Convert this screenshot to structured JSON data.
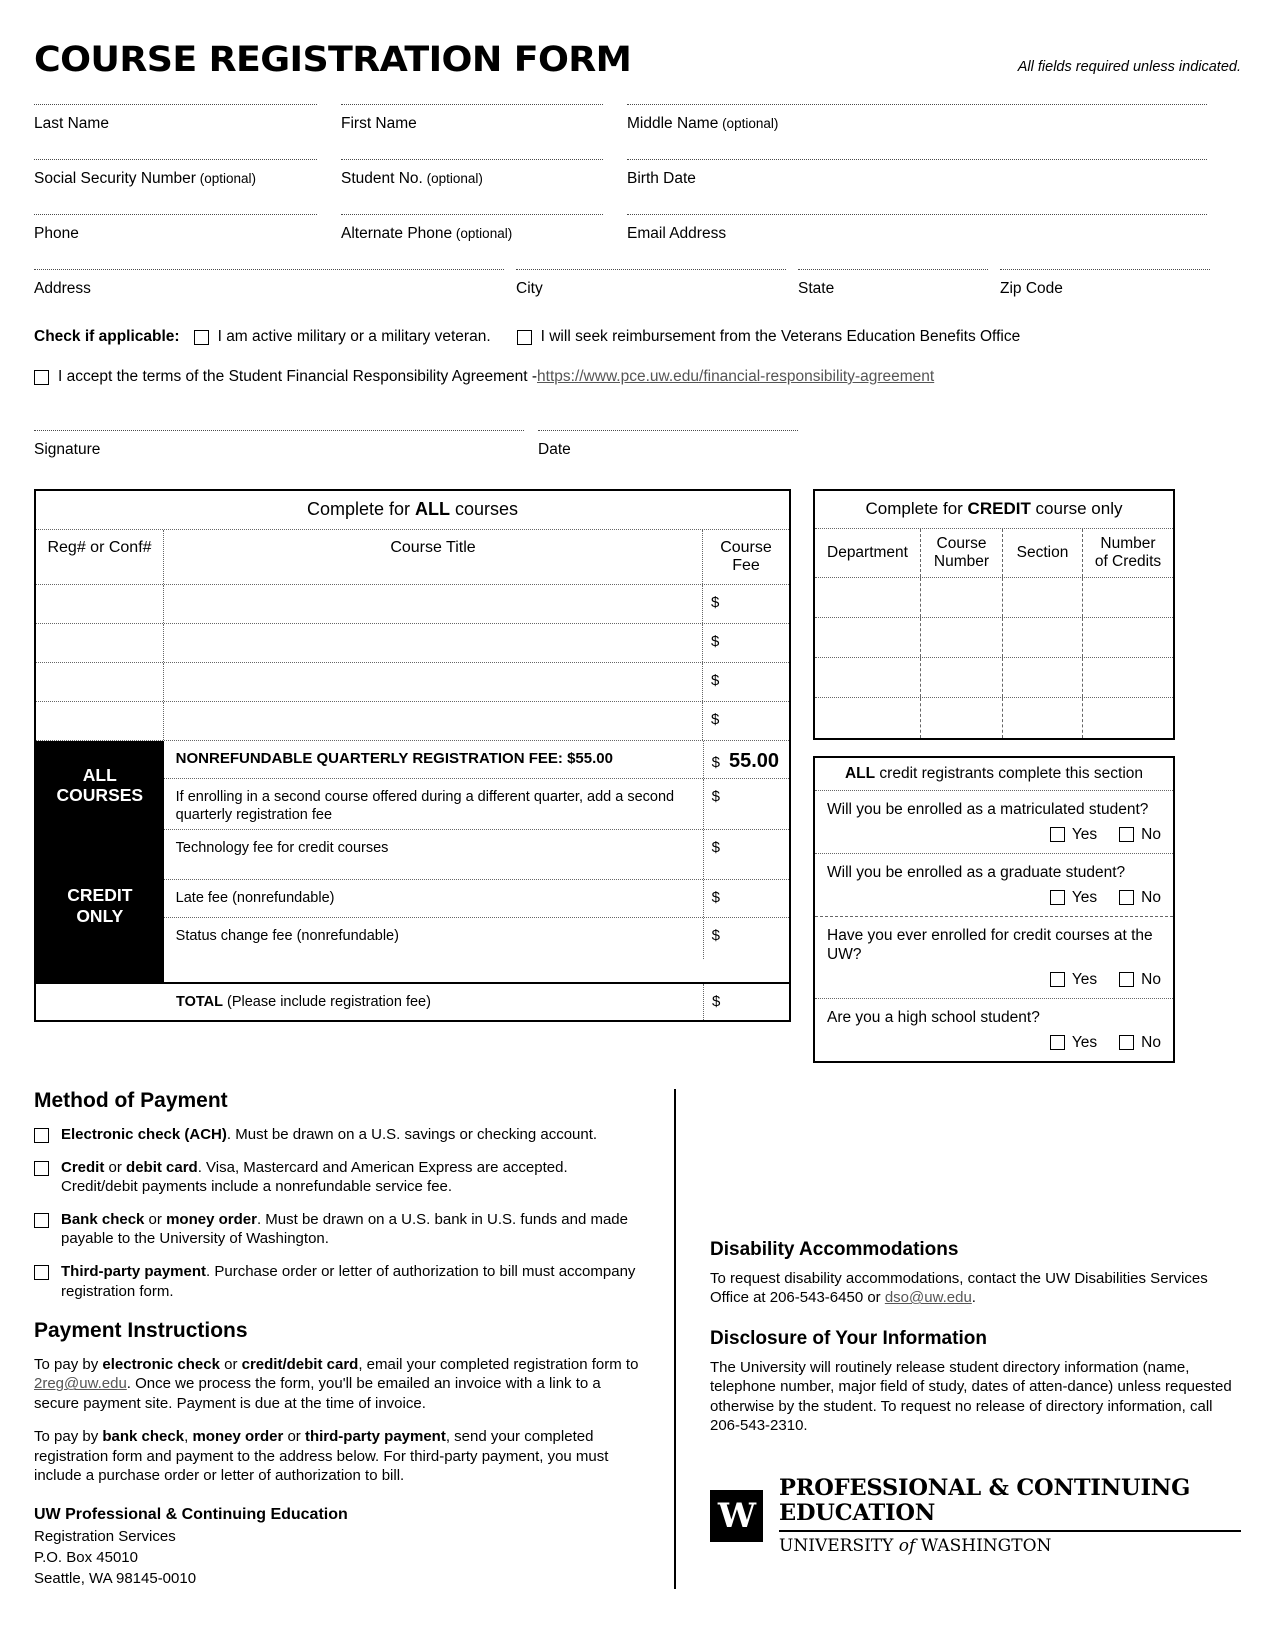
{
  "header": {
    "title": "COURSE REGISTRATION FORM",
    "note": "All fields required unless indicated."
  },
  "fields": {
    "last_name": "Last Name",
    "first_name": "First Name",
    "middle_name": "Middle Name",
    "middle_name_optional": " (optional)",
    "ssn": "Social Security Number",
    "ssn_optional": " (optional)",
    "student_no": "Student No.",
    "student_no_optional": " (optional)",
    "birth_date": "Birth Date",
    "phone": "Phone",
    "alt_phone": "Alternate Phone",
    "alt_phone_optional": " (optional)",
    "email": "Email Address",
    "address": "Address",
    "city": "City",
    "state": "State",
    "zip": "Zip Code",
    "signature": "Signature",
    "date": "Date"
  },
  "checks": {
    "prefix": "Check if applicable:",
    "military": "I am active military or a military veteran.",
    "veterans_benefits": "I will seek reimbursement from the Veterans Education Benefits Office",
    "agreement_text": "I accept the terms of the Student Financial Responsibility Agreement - ",
    "agreement_link": "https://www.pce.uw.edu/financial-responsibility-agreement"
  },
  "all_courses_table": {
    "caption_pre": "Complete for ",
    "caption_bold": "ALL",
    "caption_post": " courses",
    "columns": [
      "Reg# or Conf#",
      "Course Title",
      "Course Fee"
    ],
    "blank_rows": 4,
    "dollar": "$",
    "block_all": "ALL\nCOURSES",
    "block_all_line1": "ALL",
    "block_all_line2": "COURSES",
    "block_credit_line1": "CREDIT",
    "block_credit_line2": "ONLY",
    "fee_rows": [
      {
        "label": "NONREFUNDABLE QUARTERLY REGISTRATION FEE: $55.00",
        "bold": true,
        "amount": "55.00"
      },
      {
        "label": "If enrolling in a second course offered during a different quarter, add a second quarterly registration fee",
        "bold": false,
        "amount": ""
      },
      {
        "label": "Technology fee for credit courses",
        "bold": false,
        "amount": ""
      },
      {
        "label": "Late fee (nonrefundable)",
        "bold": false,
        "amount": ""
      },
      {
        "label": "Status change fee (nonrefundable)",
        "bold": false,
        "amount": ""
      }
    ],
    "total_bold": "TOTAL",
    "total_rest": " (Please include registration fee)"
  },
  "credit_table": {
    "caption_pre": "Complete for ",
    "caption_bold": "CREDIT",
    "caption_post": " course only",
    "columns": [
      "Department",
      "Course\nNumber",
      "Section",
      "Number\nof Credits"
    ],
    "col1": "Department",
    "col2a": "Course",
    "col2b": "Number",
    "col3": "Section",
    "col4a": "Number",
    "col4b": "of Credits",
    "blank_rows": 4
  },
  "credit_questions": {
    "caption_bold": "ALL",
    "caption_rest": " credit registrants complete this section",
    "yes": "Yes",
    "no": "No",
    "items": [
      "Will you be enrolled as a matriculated student?",
      "Will you be enrolled as a graduate student?",
      "Have you ever enrolled for credit courses at the UW?",
      "Are you a high school student?"
    ]
  },
  "payment": {
    "heading": "Method of Payment",
    "options": [
      {
        "bold": "Electronic check (ACH)",
        "rest": ". Must be drawn on a U.S. savings or checking account."
      },
      {
        "bold": "Credit",
        "mid": " or ",
        "bold2": "debit card",
        "rest": ". Visa, Mastercard and American Express are accepted. Credit/debit payments include a nonrefundable service fee."
      },
      {
        "bold": "Bank check",
        "mid": " or ",
        "bold2": "money order",
        "rest": ". Must be drawn on a U.S. bank in U.S. funds and made payable to the University of Washington."
      },
      {
        "bold": "Third-party payment",
        "rest": ". Purchase order or letter of authorization to bill must accompany registration form."
      }
    ],
    "instructions_heading": "Payment Instructions",
    "p1_a": "To pay by ",
    "p1_b1": "electronic check",
    "p1_c": " or ",
    "p1_b2": "credit/debit card",
    "p1_d": ", email your completed registration form to ",
    "p1_email": "2reg@uw.edu",
    "p1_e": ". Once we process the form, you'll be emailed an invoice with a link to a secure payment site. Payment is due at the time of invoice.",
    "p2_a": "To pay by ",
    "p2_b1": "bank check",
    "p2_c1": ", ",
    "p2_b2": "money order",
    "p2_c2": " or ",
    "p2_b3": "third-party payment",
    "p2_d": ", send your completed registration form and payment to the address below. For third-party payment, you must include a purchase order or letter of authorization to bill.",
    "mail_address": [
      "UW Professional & Continuing Education",
      "Registration Services",
      "P.O. Box 45010",
      "Seattle, WA 98145-0010"
    ]
  },
  "right_column": {
    "disability_heading": "Disability Accommodations",
    "disability_text_a": "To request disability accommodations, contact the UW Disabilities Services Office at 206-543-6450 or ",
    "disability_email": "dso@uw.edu",
    "disability_text_b": ".",
    "disclosure_heading": "Disclosure of Your Information",
    "disclosure_text": "The University will routinely release student directory information (name, telephone number, major field of study, dates of atten-dance) unless requested otherwise by the student. To request no release of directory information, call 206-543-2310."
  },
  "logo": {
    "mark": "W",
    "line1": "PROFESSIONAL & CONTINUING EDUCATION",
    "line2_a": "UNIVERSITY ",
    "line2_i": "of",
    "line2_b": " WASHINGTON"
  }
}
